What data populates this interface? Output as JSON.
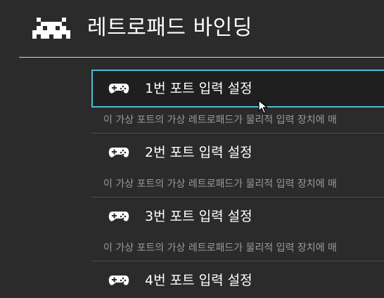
{
  "header": {
    "title": "레트로패드 바인딩",
    "logo": "retroarch-invader-logo"
  },
  "colors": {
    "background": "#2b2b2b",
    "selected_border": "#53bcd0",
    "selected_background": "#1f1f1f",
    "text": "#ffffff",
    "sublabel_text": "#9a9a9a"
  },
  "ports": [
    {
      "label": "1번 포트 입력 설정",
      "sublabel": "이 가상 포트의 가상 레트로패드가 물리적 입력 장치에 매",
      "icon": "gamepad-icon",
      "selected": true
    },
    {
      "label": "2번 포트 입력 설정",
      "sublabel": "이 가상 포트의 가상 레트로패드가 물리적 입력 장치에 매",
      "icon": "gamepad-icon",
      "selected": false
    },
    {
      "label": "3번 포트 입력 설정",
      "sublabel": "이 가상 포트의 가상 레트로패드가 물리적 입력 장치에 매",
      "icon": "gamepad-icon",
      "selected": false
    },
    {
      "label": "4번 포트 입력 설정",
      "sublabel": "",
      "icon": "gamepad-icon",
      "selected": false
    }
  ]
}
